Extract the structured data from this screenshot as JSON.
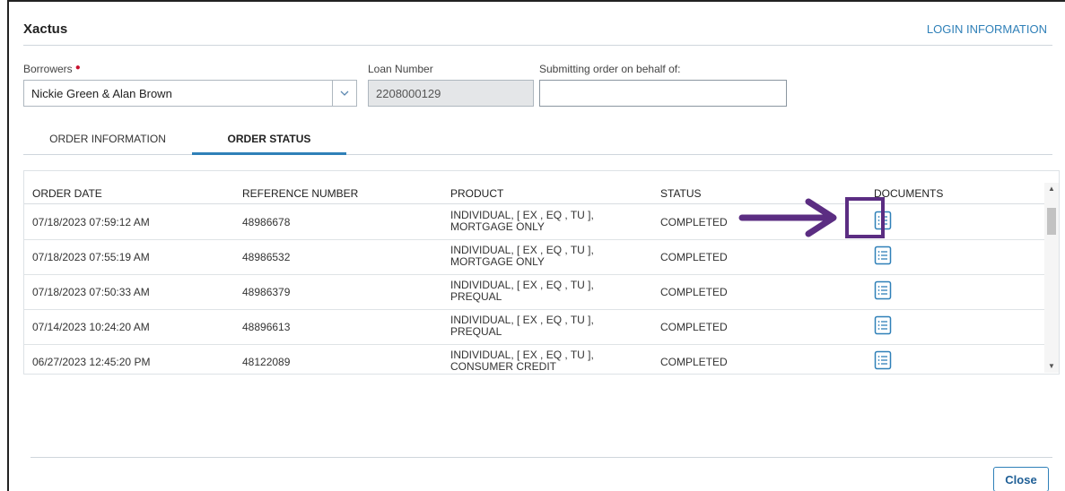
{
  "header": {
    "title": "Xactus",
    "login_link": "LOGIN INFORMATION"
  },
  "form": {
    "borrowers_label": "Borrowers",
    "borrowers_value": "Nickie Green & Alan Brown",
    "loan_number_label": "Loan Number",
    "loan_number_value": "2208000129",
    "behalf_label": "Submitting order on behalf of:",
    "behalf_value": ""
  },
  "tabs": [
    {
      "label": "ORDER INFORMATION",
      "active": false
    },
    {
      "label": "ORDER STATUS",
      "active": true
    }
  ],
  "table": {
    "columns": [
      "ORDER DATE",
      "REFERENCE NUMBER",
      "PRODUCT",
      "STATUS",
      "DOCUMENTS"
    ],
    "rows": [
      {
        "date": "07/18/2023 07:59:12 AM",
        "ref": "48986678",
        "product_line1": "INDIVIDUAL, [ EX , EQ , TU ],",
        "product_line2": "MORTGAGE ONLY",
        "status": "COMPLETED",
        "doc_icon": "document-list-icon"
      },
      {
        "date": "07/18/2023 07:55:19 AM",
        "ref": "48986532",
        "product_line1": "INDIVIDUAL, [ EX , EQ , TU ],",
        "product_line2": "MORTGAGE ONLY",
        "status": "COMPLETED",
        "doc_icon": "document-list-icon"
      },
      {
        "date": "07/18/2023 07:50:33 AM",
        "ref": "48986379",
        "product_line1": "INDIVIDUAL, [ EX , EQ , TU ],",
        "product_line2": "PREQUAL",
        "status": "COMPLETED",
        "doc_icon": "document-list-icon"
      },
      {
        "date": "07/14/2023 10:24:20 AM",
        "ref": "48896613",
        "product_line1": "INDIVIDUAL, [ EX , EQ , TU ],",
        "product_line2": "PREQUAL",
        "status": "COMPLETED",
        "doc_icon": "document-list-icon"
      },
      {
        "date": "06/27/2023 12:45:20 PM",
        "ref": "48122089",
        "product_line1": "INDIVIDUAL, [ EX , EQ , TU ],",
        "product_line2": "CONSUMER CREDIT",
        "status": "COMPLETED",
        "doc_icon": "document-list-icon"
      }
    ]
  },
  "footer": {
    "close_label": "Close"
  },
  "colors": {
    "accent": "#2f80b8",
    "annotation": "#5b2d82",
    "required": "#c8102e"
  }
}
